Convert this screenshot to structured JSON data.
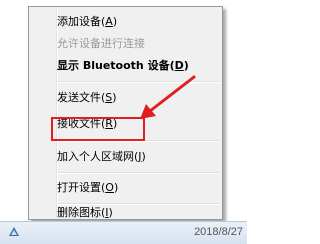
{
  "context_menu": {
    "items": [
      {
        "text": "添加设备(",
        "key": "A",
        "tail": ")"
      },
      {
        "text": "允许设备进行连接",
        "key": "",
        "tail": ""
      },
      {
        "text": "显示 Bluetooth 设备(",
        "key": "D",
        "tail": ")"
      },
      {
        "text": "发送文件(",
        "key": "S",
        "tail": ")"
      },
      {
        "text": "接收文件(",
        "key": "R",
        "tail": ")"
      },
      {
        "text": "加入个人区域网(",
        "key": "J",
        "tail": ")"
      },
      {
        "text": "打开设置(",
        "key": "O",
        "tail": ")"
      },
      {
        "text": "删除图标(",
        "key": "I",
        "tail": ")"
      }
    ]
  },
  "annotation": {
    "color": "#e02020"
  },
  "taskbar": {
    "date": "2018/8/27"
  },
  "icons": {
    "tray": "bluetooth-tray-icon"
  }
}
